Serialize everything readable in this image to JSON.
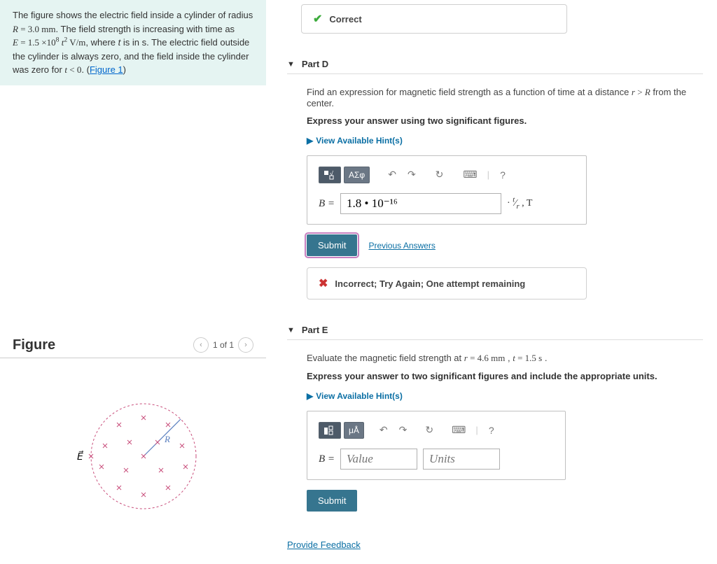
{
  "problem": {
    "intro_html": "The figure shows the electric field inside a cylinder of radius <span class='nowrap'><i>R</i> = 3.0 mm</span>. The field strength is increasing with time as <span class='nowrap'><i>E</i> = 1.5 ×10<sup>8</sup> <i>t</i><sup>2</sup> V/m</span>, where <i>t</i> is in s. The electric field outside the cylinder is always zero, and the field inside the cylinder was zero for <span class='nowrap'><i>t</i> &lt; 0</span>. (<a href='#'>Figure 1</a>)"
  },
  "figure": {
    "title": "Figure",
    "counter": "1 of 1",
    "labels": {
      "E": "E",
      "R": "R"
    }
  },
  "partC": {
    "correct_label": "Correct"
  },
  "partD": {
    "title": "Part D",
    "prompt_html": "Find an expression for magnetic field strength as a function of time at a distance <span class='nowrap'><i>r</i> &gt; <i>R</i></span> from the center.",
    "instruction": "Express your answer using two significant figures.",
    "hints_label": "View Available Hint(s)",
    "lhs": "B =",
    "input_value": "1.8 • 10⁻¹⁶",
    "units_html": "· <sup><i>t</i></sup>&frasl;<sub><i>r</i></sub> , T",
    "submit": "Submit",
    "prev": "Previous Answers",
    "feedback": "Incorrect; Try Again; One attempt remaining",
    "symbols_btn": "ΑΣφ"
  },
  "partE": {
    "title": "Part E",
    "prompt_html": "Evaluate the magnetic field strength at <span class='nowrap'><i>r</i> = 4.6 mm</span> , <span class='nowrap'><i>t</i> = 1.5 s</span> .",
    "instruction": "Express your answer to two significant figures and include the appropriate units.",
    "hints_label": "View Available Hint(s)",
    "lhs": "B =",
    "value_placeholder": "Value",
    "units_placeholder": "Units",
    "submit": "Submit",
    "units_btn": "μÅ"
  },
  "footer": {
    "provide_feedback": "Provide Feedback"
  }
}
